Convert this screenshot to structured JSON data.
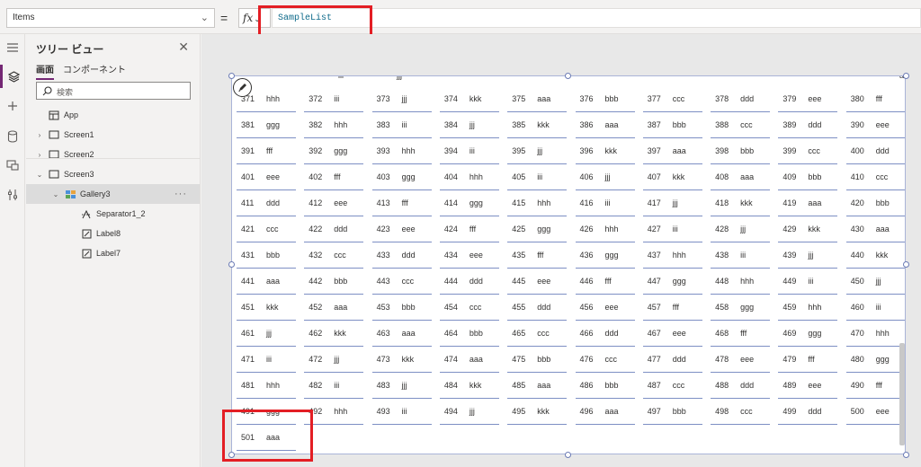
{
  "formula_bar": {
    "property": "Items",
    "equals": "=",
    "fx": "fx",
    "formula": "SampleList"
  },
  "tree": {
    "title": "ツリー ビュー",
    "tabs": [
      "画面",
      "コンポーネント"
    ],
    "search_placeholder": "検索",
    "nodes": [
      {
        "label": "App",
        "icon": "app-icon",
        "level": 0,
        "expander": ""
      },
      {
        "label": "Screen1",
        "icon": "screen-icon",
        "level": 0,
        "expander": "›"
      },
      {
        "label": "Screen2",
        "icon": "screen-icon",
        "level": 0,
        "expander": "›"
      },
      {
        "label": "Screen3",
        "icon": "screen-icon",
        "level": 0,
        "expander": "⌄"
      },
      {
        "label": "Gallery3",
        "icon": "gallery-icon",
        "level": 1,
        "expander": "⌄",
        "selected": true,
        "more": "···"
      },
      {
        "label": "Separator1_2",
        "icon": "separator-icon",
        "level": 2,
        "expander": ""
      },
      {
        "label": "Label8",
        "icon": "label-icon",
        "level": 2,
        "expander": ""
      },
      {
        "label": "Label7",
        "icon": "label-icon",
        "level": 2,
        "expander": ""
      }
    ]
  },
  "gallery": {
    "top_partial": [
      "iii",
      "jjj",
      "aaa"
    ],
    "rows": [
      [
        [
          "371",
          "hhh"
        ],
        [
          "372",
          "iii"
        ],
        [
          "373",
          "jjj"
        ],
        [
          "374",
          "kkk"
        ],
        [
          "375",
          "aaa"
        ],
        [
          "376",
          "bbb"
        ],
        [
          "377",
          "ccc"
        ],
        [
          "378",
          "ddd"
        ],
        [
          "379",
          "eee"
        ],
        [
          "380",
          "fff"
        ]
      ],
      [
        [
          "381",
          "ggg"
        ],
        [
          "382",
          "hhh"
        ],
        [
          "383",
          "iii"
        ],
        [
          "384",
          "jjj"
        ],
        [
          "385",
          "kkk"
        ],
        [
          "386",
          "aaa"
        ],
        [
          "387",
          "bbb"
        ],
        [
          "388",
          "ccc"
        ],
        [
          "389",
          "ddd"
        ],
        [
          "390",
          "eee"
        ]
      ],
      [
        [
          "391",
          "fff"
        ],
        [
          "392",
          "ggg"
        ],
        [
          "393",
          "hhh"
        ],
        [
          "394",
          "iii"
        ],
        [
          "395",
          "jjj"
        ],
        [
          "396",
          "kkk"
        ],
        [
          "397",
          "aaa"
        ],
        [
          "398",
          "bbb"
        ],
        [
          "399",
          "ccc"
        ],
        [
          "400",
          "ddd"
        ]
      ],
      [
        [
          "401",
          "eee"
        ],
        [
          "402",
          "fff"
        ],
        [
          "403",
          "ggg"
        ],
        [
          "404",
          "hhh"
        ],
        [
          "405",
          "iii"
        ],
        [
          "406",
          "jjj"
        ],
        [
          "407",
          "kkk"
        ],
        [
          "408",
          "aaa"
        ],
        [
          "409",
          "bbb"
        ],
        [
          "410",
          "ccc"
        ]
      ],
      [
        [
          "411",
          "ddd"
        ],
        [
          "412",
          "eee"
        ],
        [
          "413",
          "fff"
        ],
        [
          "414",
          "ggg"
        ],
        [
          "415",
          "hhh"
        ],
        [
          "416",
          "iii"
        ],
        [
          "417",
          "jjj"
        ],
        [
          "418",
          "kkk"
        ],
        [
          "419",
          "aaa"
        ],
        [
          "420",
          "bbb"
        ]
      ],
      [
        [
          "421",
          "ccc"
        ],
        [
          "422",
          "ddd"
        ],
        [
          "423",
          "eee"
        ],
        [
          "424",
          "fff"
        ],
        [
          "425",
          "ggg"
        ],
        [
          "426",
          "hhh"
        ],
        [
          "427",
          "iii"
        ],
        [
          "428",
          "jjj"
        ],
        [
          "429",
          "kkk"
        ],
        [
          "430",
          "aaa"
        ]
      ],
      [
        [
          "431",
          "bbb"
        ],
        [
          "432",
          "ccc"
        ],
        [
          "433",
          "ddd"
        ],
        [
          "434",
          "eee"
        ],
        [
          "435",
          "fff"
        ],
        [
          "436",
          "ggg"
        ],
        [
          "437",
          "hhh"
        ],
        [
          "438",
          "iii"
        ],
        [
          "439",
          "jjj"
        ],
        [
          "440",
          "kkk"
        ]
      ],
      [
        [
          "441",
          "aaa"
        ],
        [
          "442",
          "bbb"
        ],
        [
          "443",
          "ccc"
        ],
        [
          "444",
          "ddd"
        ],
        [
          "445",
          "eee"
        ],
        [
          "446",
          "fff"
        ],
        [
          "447",
          "ggg"
        ],
        [
          "448",
          "hhh"
        ],
        [
          "449",
          "iii"
        ],
        [
          "450",
          "jjj"
        ]
      ],
      [
        [
          "451",
          "kkk"
        ],
        [
          "452",
          "aaa"
        ],
        [
          "453",
          "bbb"
        ],
        [
          "454",
          "ccc"
        ],
        [
          "455",
          "ddd"
        ],
        [
          "456",
          "eee"
        ],
        [
          "457",
          "fff"
        ],
        [
          "458",
          "ggg"
        ],
        [
          "459",
          "hhh"
        ],
        [
          "460",
          "iii"
        ]
      ],
      [
        [
          "461",
          "jjj"
        ],
        [
          "462",
          "kkk"
        ],
        [
          "463",
          "aaa"
        ],
        [
          "464",
          "bbb"
        ],
        [
          "465",
          "ccc"
        ],
        [
          "466",
          "ddd"
        ],
        [
          "467",
          "eee"
        ],
        [
          "468",
          "fff"
        ],
        [
          "469",
          "ggg"
        ],
        [
          "470",
          "hhh"
        ]
      ],
      [
        [
          "471",
          "iii"
        ],
        [
          "472",
          "jjj"
        ],
        [
          "473",
          "kkk"
        ],
        [
          "474",
          "aaa"
        ],
        [
          "475",
          "bbb"
        ],
        [
          "476",
          "ccc"
        ],
        [
          "477",
          "ddd"
        ],
        [
          "478",
          "eee"
        ],
        [
          "479",
          "fff"
        ],
        [
          "480",
          "ggg"
        ]
      ],
      [
        [
          "481",
          "hhh"
        ],
        [
          "482",
          "iii"
        ],
        [
          "483",
          "jjj"
        ],
        [
          "484",
          "kkk"
        ],
        [
          "485",
          "aaa"
        ],
        [
          "486",
          "bbb"
        ],
        [
          "487",
          "ccc"
        ],
        [
          "488",
          "ddd"
        ],
        [
          "489",
          "eee"
        ],
        [
          "490",
          "fff"
        ]
      ],
      [
        [
          "491",
          "ggg"
        ],
        [
          "492",
          "hhh"
        ],
        [
          "493",
          "iii"
        ],
        [
          "494",
          "jjj"
        ],
        [
          "495",
          "kkk"
        ],
        [
          "496",
          "aaa"
        ],
        [
          "497",
          "bbb"
        ],
        [
          "498",
          "ccc"
        ],
        [
          "499",
          "ddd"
        ],
        [
          "500",
          "eee"
        ]
      ],
      [
        [
          "501",
          "aaa"
        ]
      ]
    ]
  },
  "colors": {
    "accent": "#742774",
    "highlight": "#e31e24",
    "separator": "#7d8fc4",
    "formula_text": "#0e6a8a"
  },
  "rail_icons": [
    "hamburger-icon",
    "layers-icon",
    "plus-icon",
    "database-icon",
    "media-icon",
    "tools-icon"
  ]
}
